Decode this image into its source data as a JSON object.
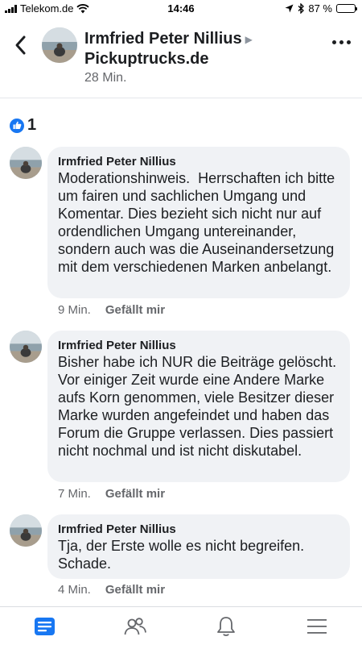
{
  "status_bar": {
    "carrier": "Telekom.de",
    "time": "14:46",
    "battery": "87 %",
    "battery_level": 0.87
  },
  "header": {
    "author": "Irmfried Peter Nillius",
    "group": "Pickuptrucks.de",
    "time_ago": "28 Min."
  },
  "likes": {
    "count": "1"
  },
  "comments": [
    {
      "author": "Irmfried Peter Nillius",
      "text": "Moderationshinweis.  Herrschaften ich bitte um fairen und sachlichen Umgang und Komentar. Dies bezieht sich nicht nur auf ordendlichen Umgang untereinander, sondern auch was die Auseinandersetzung mit dem verschiedenen Marken anbelangt.",
      "time": "9 Min.",
      "like_label": "Gefällt mir"
    },
    {
      "author": "Irmfried Peter Nillius",
      "text": "Bisher habe ich NUR die Beiträge gelöscht.   Vor einiger Zeit wurde eine Andere Marke aufs Korn genommen, viele Besitzer dieser Marke wurden angefeindet und haben das Forum die Gruppe verlassen. Dies passiert nicht nochmal und ist nicht diskutabel.",
      "time": "7 Min.",
      "like_label": "Gefällt mir"
    },
    {
      "author": "Irmfried Peter Nillius",
      "text": "Tja, der Erste wolle es nicht begreifen. Schade.",
      "time": "4 Min.",
      "like_label": "Gefällt mir"
    }
  ],
  "tabbar": {
    "items": [
      "news-feed-icon",
      "groups-icon",
      "notifications-icon",
      "menu-icon"
    ],
    "active_color": "#1877f2",
    "inactive_color": "#65676b"
  }
}
